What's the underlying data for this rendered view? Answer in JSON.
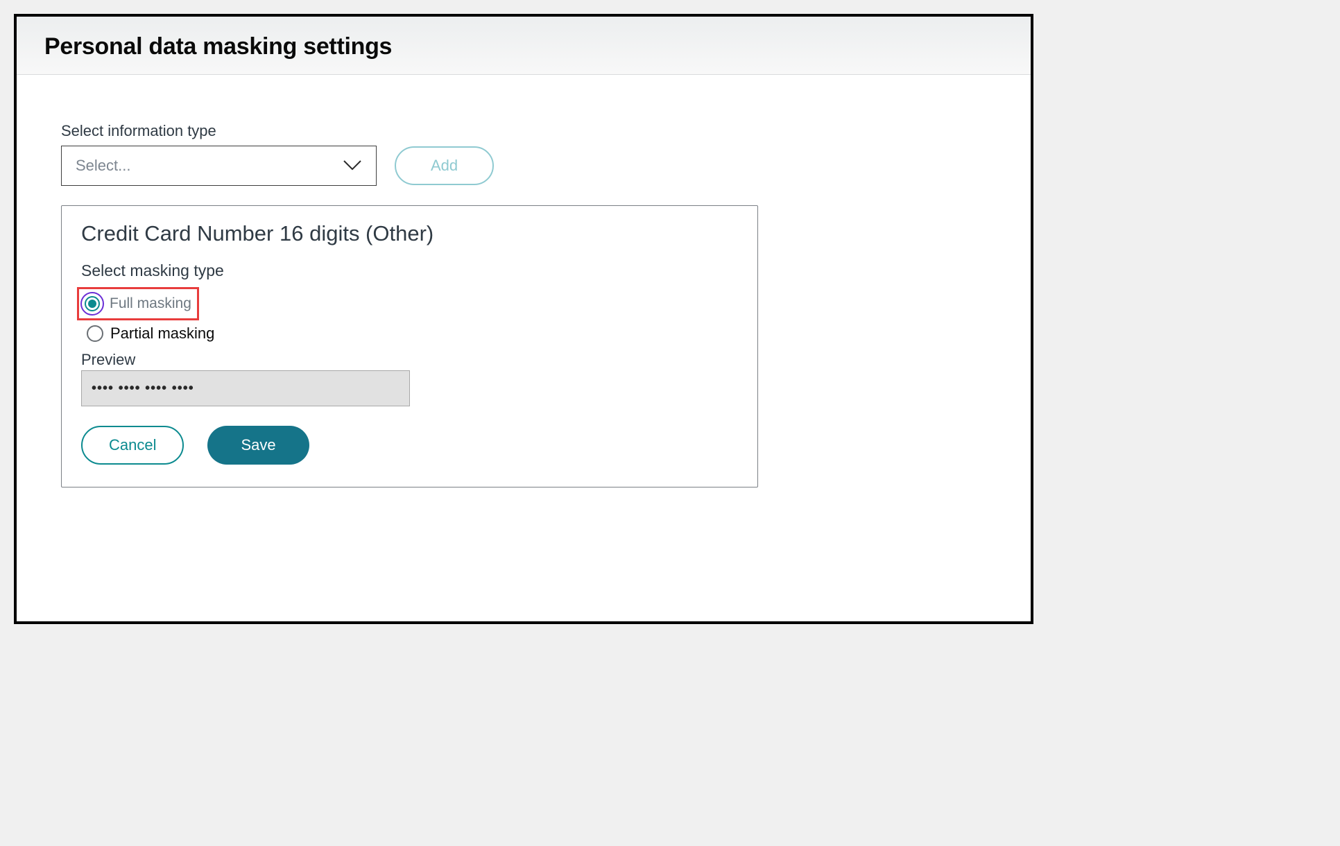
{
  "header": {
    "title": "Personal data masking settings"
  },
  "infoType": {
    "label": "Select information type",
    "placeholder": "Select...",
    "addButton": "Add"
  },
  "card": {
    "title": "Credit Card Number 16 digits (Other)",
    "maskingLabel": "Select masking type",
    "options": {
      "full": "Full masking",
      "partial": "Partial masking"
    },
    "previewLabel": "Preview",
    "previewValue": "•••• •••• •••• ••••",
    "cancel": "Cancel",
    "save": "Save"
  },
  "colors": {
    "accent": "#0b8a8f",
    "saveBg": "#157489",
    "highlight": "#e83c3c",
    "radioOuter": "#6b2fd6"
  }
}
